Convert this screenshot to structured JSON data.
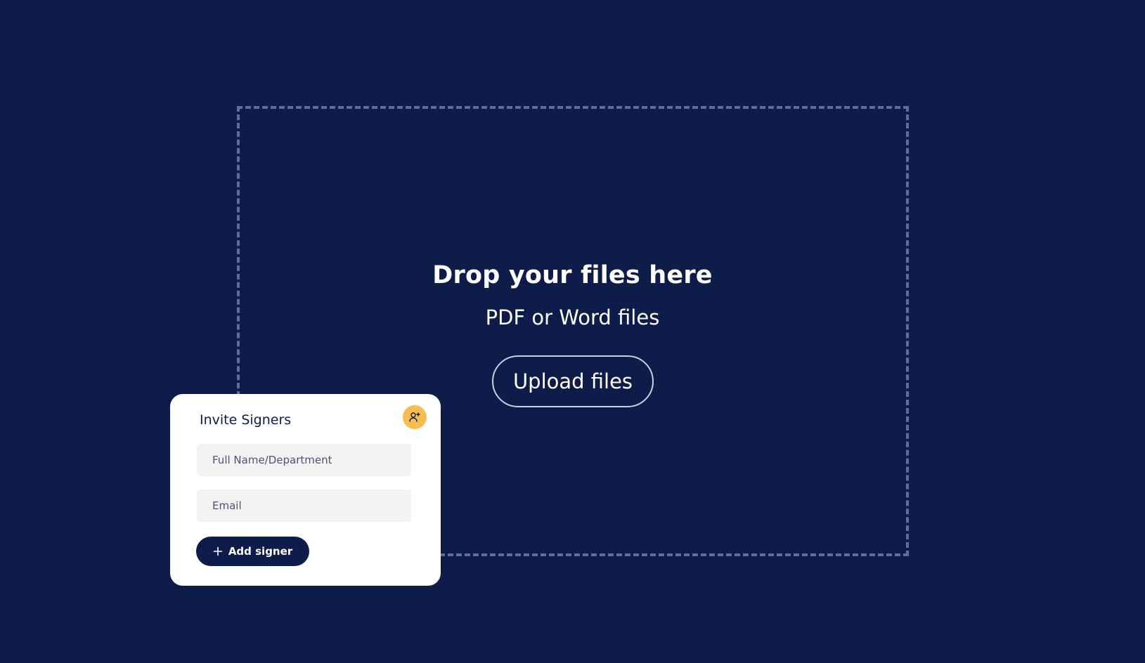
{
  "dropzone": {
    "title": "Drop your files here",
    "subtitle": "PDF or Word files",
    "upload_label": "Upload files"
  },
  "invite_card": {
    "title": "Invite Signers",
    "avatar_icon": "add-user-icon",
    "name_placeholder": "Full Name/Department",
    "email_placeholder": "Email",
    "add_label": "Add signer",
    "add_icon": "plus-icon"
  },
  "colors": {
    "background": "#0e1c4a",
    "dashed_border": "#5e6d9e",
    "accent": "#f7bd4f",
    "card": "#ffffff",
    "field": "#f3f3f3"
  }
}
